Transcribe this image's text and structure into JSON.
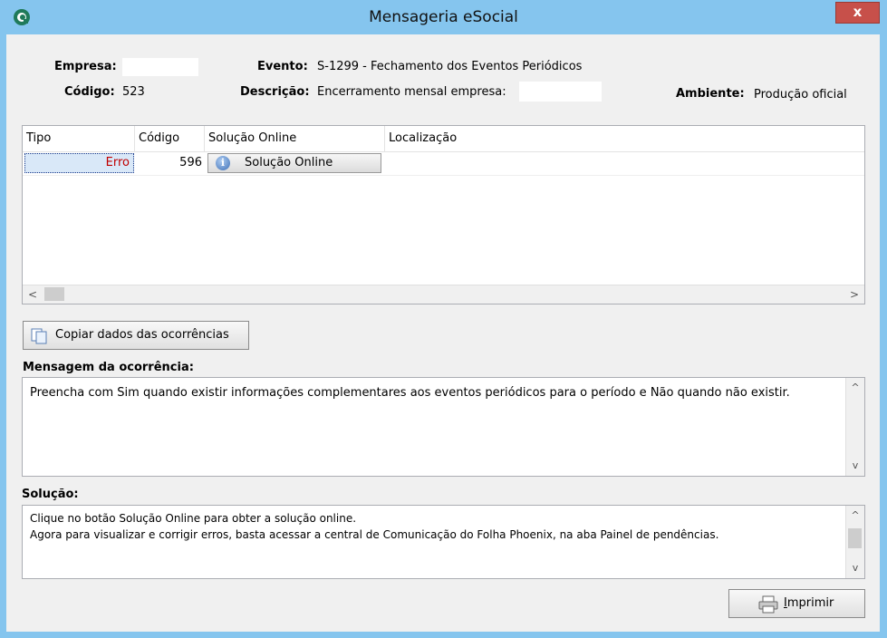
{
  "window": {
    "title": "Mensageria eSocial",
    "close_label": "x"
  },
  "info": {
    "empresa_label": "Empresa:",
    "codigo_label": "Código:",
    "codigo_value": "523",
    "evento_label": "Evento:",
    "evento_value": "S-1299 - Fechamento dos Eventos Periódicos",
    "descricao_label": "Descrição:",
    "descricao_value": "Encerramento mensal empresa:",
    "ambiente_label": "Ambiente:",
    "ambiente_value": "Produção oficial"
  },
  "grid": {
    "columns": [
      "Tipo",
      "Código",
      "Solução Online",
      "Localização"
    ],
    "rows": [
      {
        "tipo": "Erro",
        "codigo": "596",
        "solucao_button": "Solução Online",
        "localizacao": ""
      }
    ],
    "scroll_left": "<",
    "scroll_right": ">"
  },
  "copy_button": "Copiar dados das ocorrências",
  "mensagem": {
    "label": "Mensagem da ocorrência:",
    "text": "Preencha com Sim quando existir informações complementares aos eventos periódicos para o período e Não quando não existir."
  },
  "solucao": {
    "label": "Solução:",
    "line1": "Clique no botão Solução Online para obter a solução online.",
    "line2": "Agora para visualizar e corrigir erros, basta acessar a central de Comunicação do Folha Phoenix, na aba Painel de pendências."
  },
  "print_button": {
    "mnemonic": "I",
    "rest": "mprimir"
  },
  "scroll_arrows": {
    "up": "^",
    "down": "v"
  },
  "icons": {
    "app": "app-logo-icon",
    "info": "info-icon",
    "copy": "copy-icon",
    "print": "printer-icon"
  },
  "colors": {
    "error": "#c00000",
    "titlebar": "#85c5ee",
    "close": "#c7504a"
  }
}
